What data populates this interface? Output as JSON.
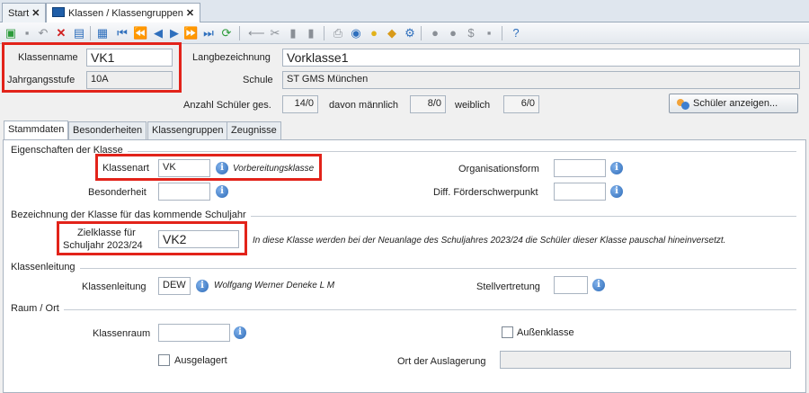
{
  "doc_tabs": {
    "start": "Start",
    "klassen": "Klassen / Klassengruppen",
    "close": "✕"
  },
  "toolbar": {
    "icons": [
      "new-icon",
      "save-icon",
      "undo-icon",
      "delete-icon",
      "export-icon",
      "copy-form-icon",
      "first-icon",
      "prev-page-icon",
      "prev-icon",
      "next-icon",
      "next-page-icon",
      "last-icon",
      "refresh-icon",
      "back-arrow-icon",
      "cut-icon",
      "copy-icon",
      "paste-icon",
      "print-icon",
      "preview-icon",
      "bulb-icon",
      "broom-icon",
      "settings-icon",
      "users-icon",
      "users-edit-icon",
      "money-icon",
      "notes-icon",
      "help-icon"
    ]
  },
  "header": {
    "klassenname_label": "Klassenname",
    "klassenname_value": "VK1",
    "jahrgangsstufe_label": "Jahrgangsstufe",
    "jahrgangsstufe_value": "10A",
    "langbezeichnung_label": "Langbezeichnung",
    "langbezeichnung_value": "Vorklasse1",
    "schule_label": "Schule",
    "schule_value": "ST GMS München",
    "anzahl_label": "Anzahl Schüler ges.",
    "anzahl_value": "14/0",
    "maennlich_label": "davon männlich",
    "maennlich_value": "8/0",
    "weiblich_label": "weiblich",
    "weiblich_value": "6/0",
    "schueler_button": "Schüler anzeigen..."
  },
  "tabs": [
    "Stammdaten",
    "Besonderheiten",
    "Klassengruppen",
    "Zeugnisse"
  ],
  "eigenschaften": {
    "title": "Eigenschaften der Klasse",
    "klassenart_label": "Klassenart",
    "klassenart_value": "VK",
    "klassenart_hint": "Vorbereitungsklasse",
    "besonderheit_label": "Besonderheit",
    "organisationsform_label": "Organisationsform",
    "foerderschwerpunkt_label": "Diff. Förderschwerpunkt"
  },
  "zielklasse": {
    "title": "Bezeichnung der Klasse für das kommende Schuljahr",
    "label_line1": "Zielklasse für",
    "label_line2": "Schuljahr 2023/24",
    "value": "VK2",
    "hint": "In diese Klasse werden bei der Neuanlage des Schuljahres 2023/24 die Schüler dieser Klasse pauschal hineinversetzt."
  },
  "klassenleitung": {
    "title": "Klassenleitung",
    "label": "Klassenleitung",
    "value": "DEW",
    "name": "Wolfgang Werner Deneke L M",
    "stellvertretung_label": "Stellvertretung"
  },
  "raum": {
    "title": "Raum / Ort",
    "klassenraum_label": "Klassenraum",
    "aussenklasse_label": "Außenklasse",
    "ausgelagert_label": "Ausgelagert",
    "ort_label": "Ort der Auslagerung"
  },
  "colors": {
    "highlight": "#e2231a",
    "info": "#2d6bb8"
  }
}
